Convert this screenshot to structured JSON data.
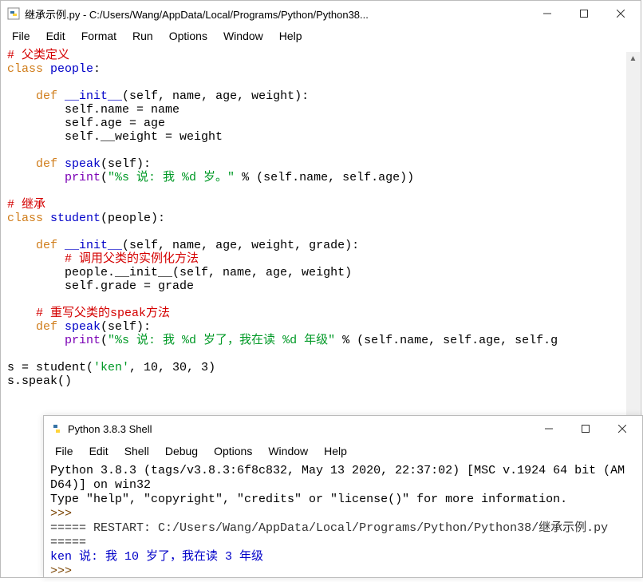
{
  "editor": {
    "title": "继承示例.py - C:/Users/Wang/AppData/Local/Programs/Python/Python38...",
    "menu": [
      "File",
      "Edit",
      "Format",
      "Run",
      "Options",
      "Window",
      "Help"
    ],
    "code": {
      "c1": "# 父类定义",
      "kw_class1": "class",
      "cls1": " people",
      "colon1": ":",
      "blank1": "",
      "indent1": "    ",
      "kw_def1": "def",
      "fn_init1": " __init__",
      "sig1": "(self, name, age, weight):",
      "body1a": "        self.name = name",
      "body1b": "        self.age = age",
      "body1c": "        self.__weight = weight",
      "blank2": "",
      "indent2": "    ",
      "kw_def2": "def",
      "fn_speak1": " speak",
      "sig2": "(self):",
      "indent_print1": "        ",
      "bi_print1": "print",
      "lp1": "(",
      "str1": "\"%s 说: 我 %d 岁。\"",
      "args1": " % (self.name, self.age))",
      "blank3": "",
      "c2": "# 继承",
      "kw_class2": "class",
      "cls2": " student",
      "inh": "(people):",
      "blank4": "",
      "indent3": "    ",
      "kw_def3": "def",
      "fn_init2": " __init__",
      "sig3": "(self, name, age, weight, grade):",
      "c3": "        # 调用父类的实例化方法",
      "body2a": "        people.__init__(self, name, age, weight)",
      "body2b": "        self.grade = grade",
      "blank5": "",
      "c4": "    # 重写父类的speak方法",
      "indent4": "    ",
      "kw_def4": "def",
      "fn_speak2": " speak",
      "sig4": "(self):",
      "indent_print2": "        ",
      "bi_print2": "print",
      "lp2": "(",
      "str2": "\"%s 说: 我 %d 岁了，我在读 %d 年级\"",
      "args2": " % (self.name, self.age, self.g",
      "blank6": "",
      "inst_a": "s = student(",
      "inst_str": "'ken'",
      "inst_b": ", 10, 30, 3)",
      "call": "s.speak()"
    }
  },
  "shell": {
    "title": "Python 3.8.3 Shell",
    "menu": [
      "File",
      "Edit",
      "Shell",
      "Debug",
      "Options",
      "Window",
      "Help"
    ],
    "line1": "Python 3.8.3 (tags/v3.8.3:6f8c832, May 13 2020, 22:37:02) [MSC v.1924 64 bit (AM",
    "line2": "D64)] on win32",
    "line3": "Type \"help\", \"copyright\", \"credits\" or \"license()\" for more information.",
    "prompt1": ">>>",
    "restart": "===== RESTART: C:/Users/Wang/AppData/Local/Programs/Python/Python38/继承示例.py",
    "restart2": "=====",
    "output": "ken 说: 我 10 岁了，我在读 3 年级",
    "prompt2": ">>>"
  },
  "winctrl": {
    "min": "—",
    "max": "▢",
    "close": "✕"
  }
}
